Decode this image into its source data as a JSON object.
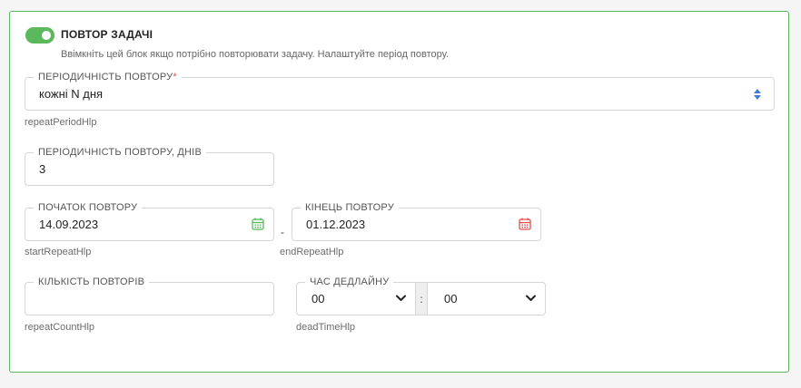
{
  "repeat": {
    "toggle_on": true,
    "title": "ПОВТОР ЗАДАЧІ",
    "description": "Ввімкніть цей блок якщо потрібно повторювати задачу. Налаштуйте період повтору."
  },
  "period": {
    "label": "ПЕРІОДИЧНІСТЬ ПОВТОРУ",
    "required_mark": "*",
    "value": "кожні N дня",
    "help": "repeatPeriodHlp"
  },
  "period_days": {
    "label": "ПЕРІОДИЧНІСТЬ ПОВТОРУ, ДНІВ",
    "value": "3"
  },
  "start": {
    "label": "ПОЧАТОК ПОВТОРУ",
    "value": "14.09.2023",
    "help": "startRepeatHlp",
    "icon": "calendar-icon",
    "icon_color": "#5cb85c"
  },
  "separator": "-",
  "end": {
    "label": "КІНЕЦЬ ПОВТОРУ",
    "value": "01.12.2023",
    "help": "endRepeatHlp",
    "icon": "calendar-icon",
    "icon_color": "#e05252"
  },
  "count": {
    "label": "КІЛЬКІСТЬ ПОВТОРІВ",
    "value": "",
    "help": "repeatCountHlp"
  },
  "deadline": {
    "label": "ЧАС ДЕДЛАЙНУ",
    "hours": "00",
    "colon": ":",
    "minutes": "00",
    "help": "deadTimeHlp"
  },
  "colors": {
    "accent": "#5cb85c",
    "required": "#e05252",
    "sort_icon": "#3b7dd8"
  }
}
